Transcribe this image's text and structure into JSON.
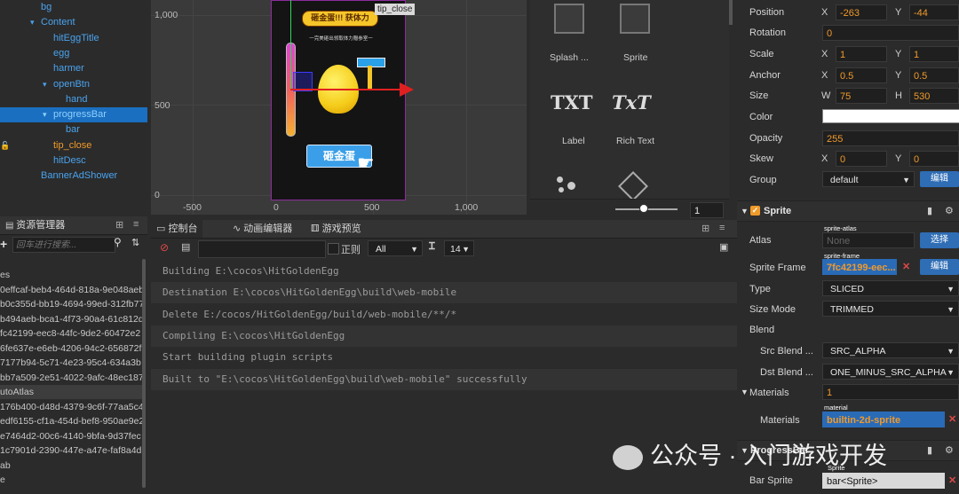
{
  "hierarchy": {
    "items": [
      {
        "label": "bg",
        "indent": 46,
        "arrow": "",
        "style": ""
      },
      {
        "label": "Content",
        "indent": 46,
        "arrow": "▾",
        "style": ""
      },
      {
        "label": "hitEggTitle",
        "indent": 60,
        "arrow": "",
        "style": ""
      },
      {
        "label": "egg",
        "indent": 60,
        "arrow": "",
        "style": ""
      },
      {
        "label": "harmer",
        "indent": 60,
        "arrow": "",
        "style": ""
      },
      {
        "label": "openBtn",
        "indent": 60,
        "arrow": "▾",
        "style": ""
      },
      {
        "label": "hand",
        "indent": 74,
        "arrow": "",
        "style": ""
      },
      {
        "label": "progressBar",
        "indent": 60,
        "arrow": "▾",
        "style": "sel"
      },
      {
        "label": "bar",
        "indent": 74,
        "arrow": "",
        "style": ""
      },
      {
        "label": "tip_close",
        "indent": 60,
        "arrow": "",
        "style": "orange"
      },
      {
        "label": "hitDesc",
        "indent": 60,
        "arrow": "",
        "style": ""
      },
      {
        "label": "BannerAdShower",
        "indent": 46,
        "arrow": "",
        "style": ""
      }
    ]
  },
  "assets": {
    "tab_title": "资源管理器",
    "search_placeholder": "回车进行搜索...",
    "rows": [
      "es",
      "0effcaf-beb4-464d-818a-9e048aeb",
      "b0c355d-bb19-4694-99ed-312fb77",
      "b494aeb-bca1-4f73-90a4-61c812d",
      "fc42199-eec8-44fc-9de2-60472e2",
      "6fe637e-e6eb-4206-94c2-656872f",
      "7177b94-5c71-4e23-95c4-634a3b",
      "bb7a509-2e51-4022-9afc-48ec187",
      "utoAtlas",
      "176b400-d48d-4379-9c6f-77aa5c4",
      "edf6155-cf1a-454d-bef8-950ae9e2",
      "e7464d2-00c6-4140-9bfa-9d37fec",
      "1c7901d-2390-447e-a47e-faf8a4d",
      "ab",
      "e"
    ]
  },
  "scene": {
    "y_labels": [
      "1,000",
      "500",
      "0"
    ],
    "x_labels": [
      "-500",
      "0",
      "500",
      "1,000"
    ],
    "tooltip": "tip_close",
    "game_title": "砸金蛋!!! 获体力",
    "game_subtitle": "一完美砸出领取体力赠参室一",
    "game_button": "砸金蛋"
  },
  "library": {
    "items": [
      "Splash ...",
      "Sprite",
      "Label",
      "Rich Text"
    ],
    "txt_icon": "TXT",
    "richtxt_icon": "TxT",
    "zoom_value": "1"
  },
  "console_panel": {
    "tabs": [
      "控制台",
      "动画编辑器",
      "游戏预览"
    ],
    "regex_label": "正则",
    "filter_value": "All",
    "font_size": "14",
    "lines": [
      "Building E:\\cocos\\HitGoldenEgg",
      "Destination E:\\cocos\\HitGoldenEgg\\build\\web-mobile",
      "Delete E:/cocos/HitGoldenEgg/build/web-mobile/**/*",
      "Compiling E:\\cocos\\HitGoldenEgg",
      "Start building plugin scripts",
      "Built to \"E:\\cocos\\HitGoldenEgg\\build\\web-mobile\" successfully"
    ]
  },
  "inspector": {
    "position": {
      "label": "Position",
      "x": "-263",
      "y": "-44"
    },
    "rotation": {
      "label": "Rotation",
      "value": "0"
    },
    "scale": {
      "label": "Scale",
      "x": "1",
      "y": "1"
    },
    "anchor": {
      "label": "Anchor",
      "x": "0.5",
      "y": "0.5"
    },
    "size": {
      "label": "Size",
      "w": "75",
      "h": "530"
    },
    "color_label": "Color",
    "opacity": {
      "label": "Opacity",
      "value": "255"
    },
    "skew": {
      "label": "Skew",
      "x": "0",
      "y": "0"
    },
    "group": {
      "label": "Group",
      "value": "default",
      "edit": "编辑"
    },
    "sprite_header": "Sprite",
    "atlas": {
      "label": "Atlas",
      "tag": "sprite-atlas",
      "value": "None",
      "button": "选择"
    },
    "sprite_frame": {
      "label": "Sprite Frame",
      "tag": "sprite-frame",
      "value": "7fc42199-eec...",
      "button": "编辑"
    },
    "type": {
      "label": "Type",
      "value": "SLICED"
    },
    "size_mode": {
      "label": "Size Mode",
      "value": "TRIMMED"
    },
    "blend_label": "Blend",
    "src_blend": {
      "label": "Src Blend ...",
      "value": "SRC_ALPHA"
    },
    "dst_blend": {
      "label": "Dst Blend ...",
      "value": "ONE_MINUS_SRC_ALPHA"
    },
    "materials_count": {
      "label": "Materials",
      "value": "1"
    },
    "materials_item": {
      "label": "Materials",
      "tag": "material",
      "value": "builtin-2d-sprite"
    },
    "progressbar_header": "ProgressBar",
    "bar_sprite": {
      "label": "Bar Sprite",
      "tag": "Sprite",
      "value": "bar<Sprite>"
    },
    "x_axis": "X",
    "y_axis": "Y",
    "w_axis": "W",
    "h_axis": "H"
  },
  "watermark": "公众号 · 入门游戏开发"
}
